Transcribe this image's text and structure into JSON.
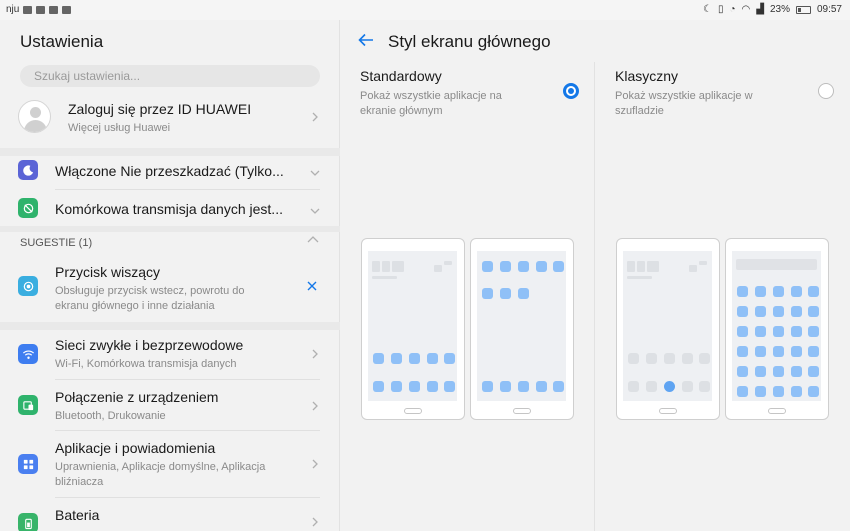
{
  "status_bar": {
    "carrier": "nju",
    "battery": "23%",
    "time": "09:57"
  },
  "left": {
    "title": "Ustawienia",
    "search_placeholder": "Szukaj ustawienia...",
    "account": {
      "title": "Zaloguj się przez ID HUAWEI",
      "subtitle": "Więcej usług Huawei"
    },
    "dnd": {
      "label": "Włączone Nie przeszkadzać (Tylko..."
    },
    "mobile_data": {
      "label": "Komórkowa transmisja danych jest..."
    },
    "suggestions_header": "SUGESTIE (1)",
    "suggestion": {
      "title": "Przycisk wiszący",
      "subtitle": "Obsługuje przycisk wstecz, powrotu do ekranu głównego i inne działania"
    },
    "items": [
      {
        "title": "Sieci zwykłe i bezprzewodowe",
        "subtitle": "Wi-Fi, Komórkowa transmisja danych",
        "color": "#3e7df0"
      },
      {
        "title": "Połączenie z urządzeniem",
        "subtitle": "Bluetooth, Drukowanie",
        "color": "#2fb36c"
      },
      {
        "title": "Aplikacje i powiadomienia",
        "subtitle": "Uprawnienia, Aplikacje domyślne, Aplikacja bliźniacza",
        "color": "#4a7ff0"
      },
      {
        "title": "Bateria",
        "subtitle": "",
        "color": "#38b46a"
      }
    ]
  },
  "right": {
    "title": "Styl ekranu głównego",
    "options": [
      {
        "title": "Standardowy",
        "subtitle": "Pokaż wszystkie aplikacje na ekranie głównym",
        "selected": true
      },
      {
        "title": "Klasyczny",
        "subtitle": "Pokaż wszystkie aplikacje w szufladzie",
        "selected": false
      }
    ]
  },
  "colors": {
    "accent": "#1478e8",
    "app_tile": "#8fc0f7"
  }
}
